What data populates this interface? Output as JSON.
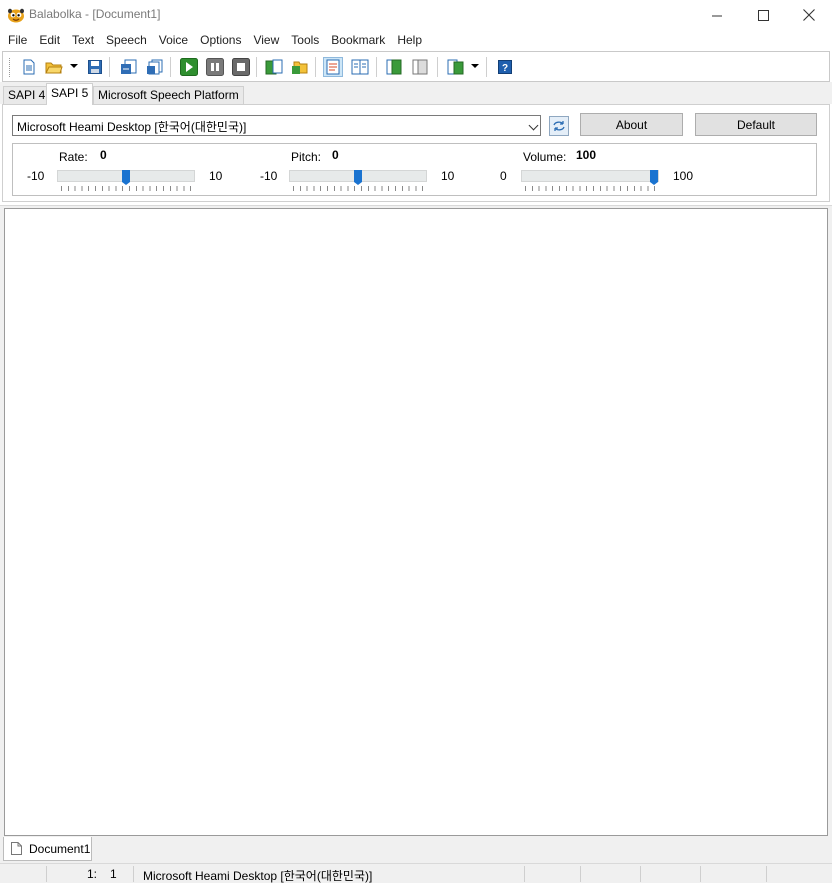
{
  "window": {
    "title": "Balabolka - [Document1]",
    "controls": [
      "minimize",
      "maximize",
      "close"
    ]
  },
  "menu": [
    "File",
    "Edit",
    "Text",
    "Speech",
    "Voice",
    "Options",
    "View",
    "Tools",
    "Bookmark",
    "Help"
  ],
  "toolbar": {
    "buttons": [
      "new-document-icon",
      "open-folder-icon",
      "save-icon",
      "export-audio-icon",
      "batch-convert-icon",
      "play-icon",
      "pause-icon",
      "stop-icon",
      "read-clipboard-icon",
      "read-file-icon",
      "text-view-icon",
      "split-view-icon",
      "dictionary-add-icon",
      "dictionary-icon",
      "bookmarks-icon",
      "help-icon"
    ],
    "active": "text-view-icon"
  },
  "engine_tabs": [
    "SAPI 4",
    "SAPI 5",
    "Microsoft Speech Platform"
  ],
  "selected_engine_tab": "SAPI 5",
  "voice": {
    "selected": "Microsoft Heami Desktop [한국어(대한민국)]",
    "about_label": "About",
    "default_label": "Default"
  },
  "params": {
    "rate": {
      "label": "Rate:",
      "value": "0",
      "min": "-10",
      "max": "10",
      "fraction": 0.5
    },
    "pitch": {
      "label": "Pitch:",
      "value": "0",
      "min": "-10",
      "max": "10",
      "fraction": 0.5
    },
    "volume": {
      "label": "Volume:",
      "value": "100",
      "min": "0",
      "max": "100",
      "fraction": 1.0
    }
  },
  "document_tab": "Document1",
  "status": {
    "line": "1:",
    "col": "1",
    "voice": "Microsoft Heami Desktop [한국어(대한민국)]"
  },
  "colors": {
    "accent": "#1a73d0",
    "panel": "#f0f0f0"
  }
}
